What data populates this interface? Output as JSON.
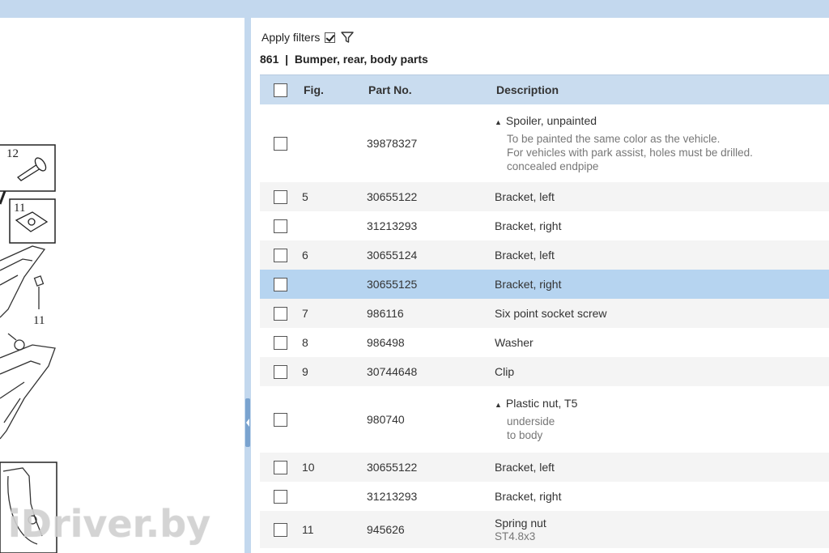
{
  "diagram": {
    "callouts": [
      "12",
      "11"
    ],
    "labels": [
      "11"
    ]
  },
  "filters": {
    "apply_label": "Apply filters",
    "apply_checked": true
  },
  "section": {
    "title": "861  |  Bumper, rear, body parts"
  },
  "table": {
    "columns": [
      "Fig.",
      "Part No.",
      "Description"
    ],
    "rows": [
      {
        "fig": "",
        "part": "39878327",
        "title": "Spoiler, unpainted",
        "expand": true,
        "notes": [
          "To be painted the same color as the vehicle.",
          "For vehicles with park assist, holes must be drilled.",
          "concealed endpipe"
        ]
      },
      {
        "fig": "5",
        "part": "30655122",
        "title": "Bracket, left",
        "notes": []
      },
      {
        "fig": "",
        "part": "31213293",
        "title": "Bracket, right",
        "notes": []
      },
      {
        "fig": "6",
        "part": "30655124",
        "title": "Bracket, left",
        "notes": []
      },
      {
        "fig": "",
        "part": "30655125",
        "title": "Bracket, right",
        "notes": [],
        "selected": true
      },
      {
        "fig": "7",
        "part": "986116",
        "title": "Six point socket screw",
        "notes": []
      },
      {
        "fig": "8",
        "part": "986498",
        "title": "Washer",
        "notes": []
      },
      {
        "fig": "9",
        "part": "30744648",
        "title": "Clip",
        "notes": []
      },
      {
        "fig": "",
        "part": "980740",
        "title": "Plastic nut, T5",
        "expand": true,
        "notes": [
          "underside",
          "to body"
        ]
      },
      {
        "fig": "10",
        "part": "30655122",
        "title": "Bracket, left",
        "notes": []
      },
      {
        "fig": "",
        "part": "31213293",
        "title": "Bracket, right",
        "notes": []
      },
      {
        "fig": "11",
        "part": "945626",
        "title": "Spring nut",
        "notes": [
          "ST4.8x3"
        ]
      }
    ]
  },
  "watermark": "iDriver.by",
  "colors": {
    "header_bg": "#c9dcef",
    "selected_row": "#b6d4f0",
    "topbar": "#c3d8ee"
  }
}
